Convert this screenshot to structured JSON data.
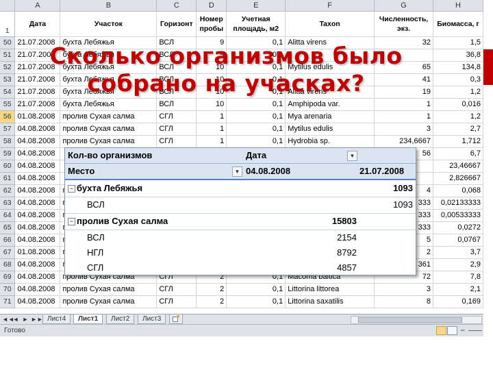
{
  "columns": [
    "",
    "A",
    "B",
    "C",
    "D",
    "E",
    "F",
    "G",
    "H"
  ],
  "header_row": {
    "num": "1",
    "cells": [
      "Дата",
      "Участок",
      "Горизонт",
      "Номер пробы",
      "Учетная площадь, м2",
      "Taxon",
      "Численность, экз.",
      "Биомасса, г"
    ]
  },
  "rows": [
    {
      "num": "50",
      "cells": [
        "21.07.2008",
        "бухта Лебяжья",
        "ВСЛ",
        "9",
        "0,1",
        "Alitta virens",
        "32",
        "1,5"
      ]
    },
    {
      "num": "51",
      "cells": [
        "21.07.2008",
        "бухта Лебяжья",
        "ВСЛ",
        "9",
        "0,1",
        "",
        "",
        "36,8"
      ]
    },
    {
      "num": "52",
      "cells": [
        "21.07.2008",
        "бухта Лебяжья",
        "ВСЛ",
        "10",
        "0,1",
        "Mytilus edulis",
        "65",
        "134,8"
      ]
    },
    {
      "num": "53",
      "cells": [
        "21.07.2008",
        "бухта Лебяжья",
        "ВСЛ",
        "10",
        "0,1",
        "",
        "41",
        "0,3"
      ]
    },
    {
      "num": "54",
      "cells": [
        "21.07.2008",
        "бухта Лебяжья",
        "ВСЛ",
        "10",
        "0,1",
        "Alitta virens",
        "19",
        "1,2"
      ]
    },
    {
      "num": "55",
      "cells": [
        "21.07.2008",
        "бухта Лебяжья",
        "ВСЛ",
        "10",
        "0,1",
        "Amphipoda var.",
        "1",
        "0,016"
      ]
    },
    {
      "num": "56",
      "cells": [
        "01.08.2008",
        "пролив Сухая салма",
        "СГЛ",
        "1",
        "0,1",
        "Mya arenaria",
        "1",
        "1,2"
      ]
    },
    {
      "num": "57",
      "cells": [
        "04.08.2008",
        "пролив Сухая салма",
        "СГЛ",
        "1",
        "0,1",
        "Mytilus edulis",
        "3",
        "2,7"
      ]
    },
    {
      "num": "58",
      "cells": [
        "04.08.2008",
        "пролив Сухая салма",
        "СГЛ",
        "1",
        "0,1",
        "Hydrobia sp.",
        "234,6667",
        "1,712"
      ]
    },
    {
      "num": "59",
      "cells": [
        "04.08.2008",
        "",
        "",
        "",
        "",
        "",
        "56",
        "6,7"
      ]
    },
    {
      "num": "60",
      "cells": [
        "04.08.2008",
        "",
        "",
        "",
        "",
        "",
        "",
        "23,46667"
      ]
    },
    {
      "num": "61",
      "cells": [
        "04.08.2008",
        "",
        "",
        "",
        "",
        "",
        "",
        "2,826667"
      ]
    },
    {
      "num": "62",
      "cells": [
        "04.08.2008",
        "п",
        "",
        "",
        "",
        "",
        "4",
        "0,068"
      ]
    },
    {
      "num": "63",
      "cells": [
        "04.08.2008",
        "п",
        "",
        "",
        "",
        "",
        "333",
        "0,02133333"
      ]
    },
    {
      "num": "64",
      "cells": [
        "04.08.2008",
        "п",
        "",
        "",
        "",
        "",
        "333",
        "0,00533333"
      ]
    },
    {
      "num": "65",
      "cells": [
        "04.08.2008",
        "п",
        "",
        "",
        "",
        "",
        "333",
        "0,0272"
      ]
    },
    {
      "num": "66",
      "cells": [
        "04.08.2008",
        "п",
        "",
        "",
        "",
        "",
        "5",
        "0,0767"
      ]
    },
    {
      "num": "67",
      "cells": [
        "01.08.2008",
        "п",
        "",
        "",
        "",
        "",
        "2",
        "3,7"
      ]
    },
    {
      "num": "68",
      "cells": [
        "04.08.2008",
        "п",
        "",
        "",
        "",
        "",
        "361",
        "2,9"
      ]
    },
    {
      "num": "69",
      "cells": [
        "04.08.2008",
        "пролив Сухая салма",
        "СГЛ",
        "2",
        "0,1",
        "Macoma baltica",
        "72",
        "7,8"
      ]
    },
    {
      "num": "70",
      "cells": [
        "04.08.2008",
        "пролив Сухая салма",
        "СГЛ",
        "2",
        "0,1",
        "Littorina littorea",
        "3",
        "2,1"
      ]
    },
    {
      "num": "71",
      "cells": [
        "04.08.2008",
        "пролив Сухая салма",
        "СГЛ",
        "2",
        "0,1",
        "Littorina saxatilis",
        "8",
        "0,169"
      ]
    }
  ],
  "overlay_title": "Сколько организмов было собрано на учасках?",
  "pivot": {
    "value_field": "Кол-во организмов",
    "col_field": "Дата",
    "row_field": "Место",
    "col_headers": [
      "04.08.2008",
      "21.07.2008"
    ],
    "groups": [
      {
        "name": "бухта Лебяжья",
        "col1": "",
        "col2": "1093",
        "items": [
          {
            "name": "ВСЛ",
            "col1": "",
            "col2": "1093"
          }
        ]
      },
      {
        "name": "пролив Сухая салма",
        "col1": "15803",
        "col2": "",
        "items": [
          {
            "name": "ВСЛ",
            "col1": "2154",
            "col2": ""
          },
          {
            "name": "НГЛ",
            "col1": "8792",
            "col2": ""
          },
          {
            "name": "СГЛ",
            "col1": "4857",
            "col2": ""
          }
        ]
      }
    ]
  },
  "sheet_tabs": [
    "Лист4",
    "Лист1",
    "Лист2",
    "Лист3"
  ],
  "active_tab": "Лист1",
  "nav_buttons": [
    "◄◄",
    "◄",
    "►",
    "►►"
  ],
  "status": {
    "ready": "Готово",
    "zoom_minus": "−"
  },
  "colors": {
    "accent": "#c00000",
    "pivot_header": "#dbe5f1",
    "pivot_border": "#4f81bd",
    "selected_header": "#f8d888"
  }
}
